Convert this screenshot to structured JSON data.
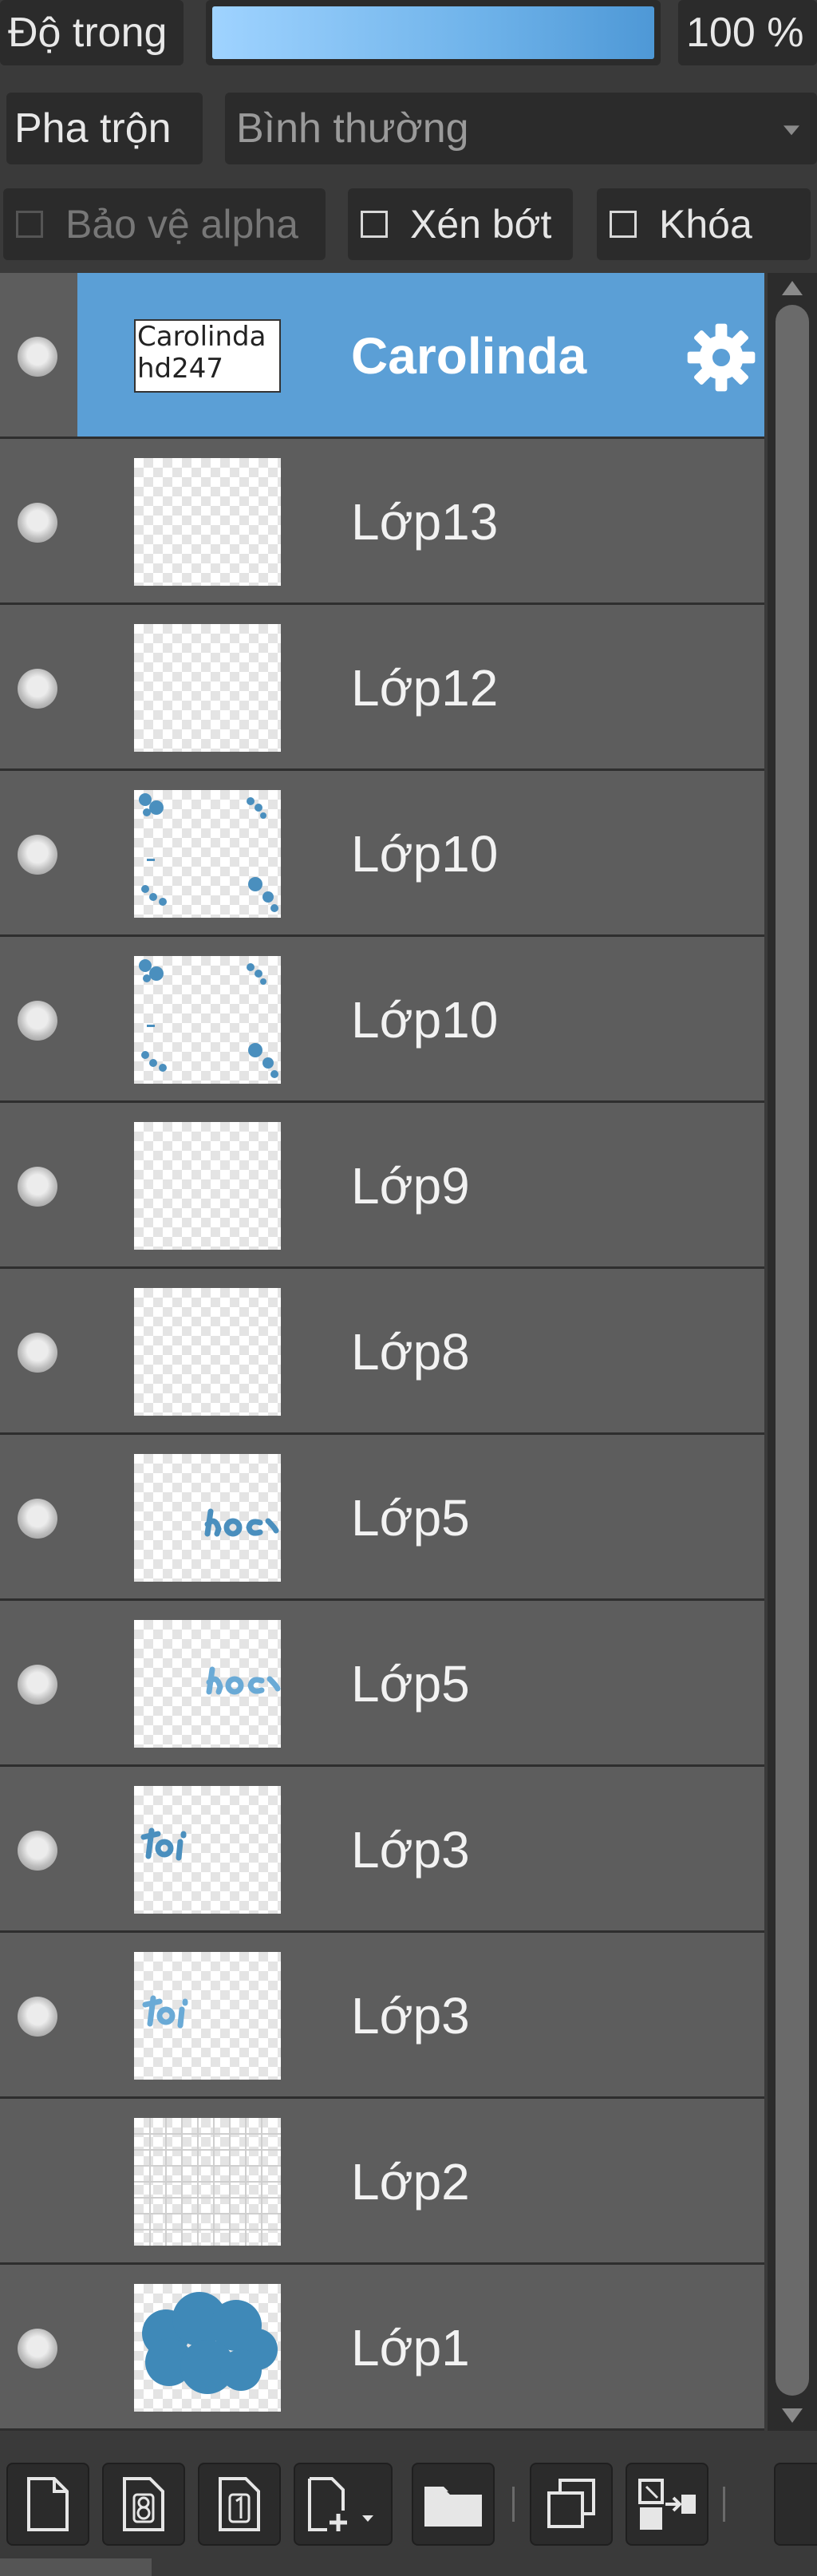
{
  "opacity": {
    "label": "Độ trong",
    "value_text": "100 %",
    "value": 1.0
  },
  "blend": {
    "label": "Pha trộn",
    "selected": "Bình thường"
  },
  "checkboxes": [
    {
      "label": "Bảo vệ alpha",
      "checked": false,
      "enabled": false
    },
    {
      "label": "Xén bớt",
      "checked": false,
      "enabled": true
    },
    {
      "label": "Khóa",
      "checked": false,
      "enabled": true
    }
  ],
  "layers": [
    {
      "name": "Carolinda",
      "visible": true,
      "selected": true,
      "type": "text",
      "thumb_text": "Carolinda hd247"
    },
    {
      "name": "Lớp13",
      "visible": true,
      "thumb": "empty"
    },
    {
      "name": "Lớp12",
      "visible": true,
      "thumb": "empty"
    },
    {
      "name": "Lớp10",
      "visible": true,
      "thumb": "frame-dots"
    },
    {
      "name": "Lớp10",
      "visible": true,
      "thumb": "frame-dots"
    },
    {
      "name": "Lớp9",
      "visible": true,
      "thumb": "empty"
    },
    {
      "name": "Lớp8",
      "visible": true,
      "thumb": "empty"
    },
    {
      "name": "Lớp5",
      "visible": true,
      "thumb": "word-hoc"
    },
    {
      "name": "Lớp5",
      "visible": true,
      "thumb": "word-hoc"
    },
    {
      "name": "Lớp3",
      "visible": true,
      "thumb": "word-toi"
    },
    {
      "name": "Lớp3",
      "visible": true,
      "thumb": "word-toi"
    },
    {
      "name": "Lớp2",
      "visible": false,
      "thumb": "grid"
    },
    {
      "name": "Lớp1",
      "visible": true,
      "thumb": "cloud"
    }
  ],
  "toolbar": {
    "buttons": [
      "new-layer-icon",
      "new-8bit-layer-icon",
      "new-1bit-layer-icon",
      "add-layer-menu-icon",
      "folder-icon",
      "duplicate-layer-icon",
      "merge-layer-icon"
    ]
  },
  "colors": {
    "selected": "#5b9fd6",
    "accent_blue": "#4a8fbe",
    "panel": "#5d5d5d",
    "control_bg": "#2b2b2b"
  }
}
